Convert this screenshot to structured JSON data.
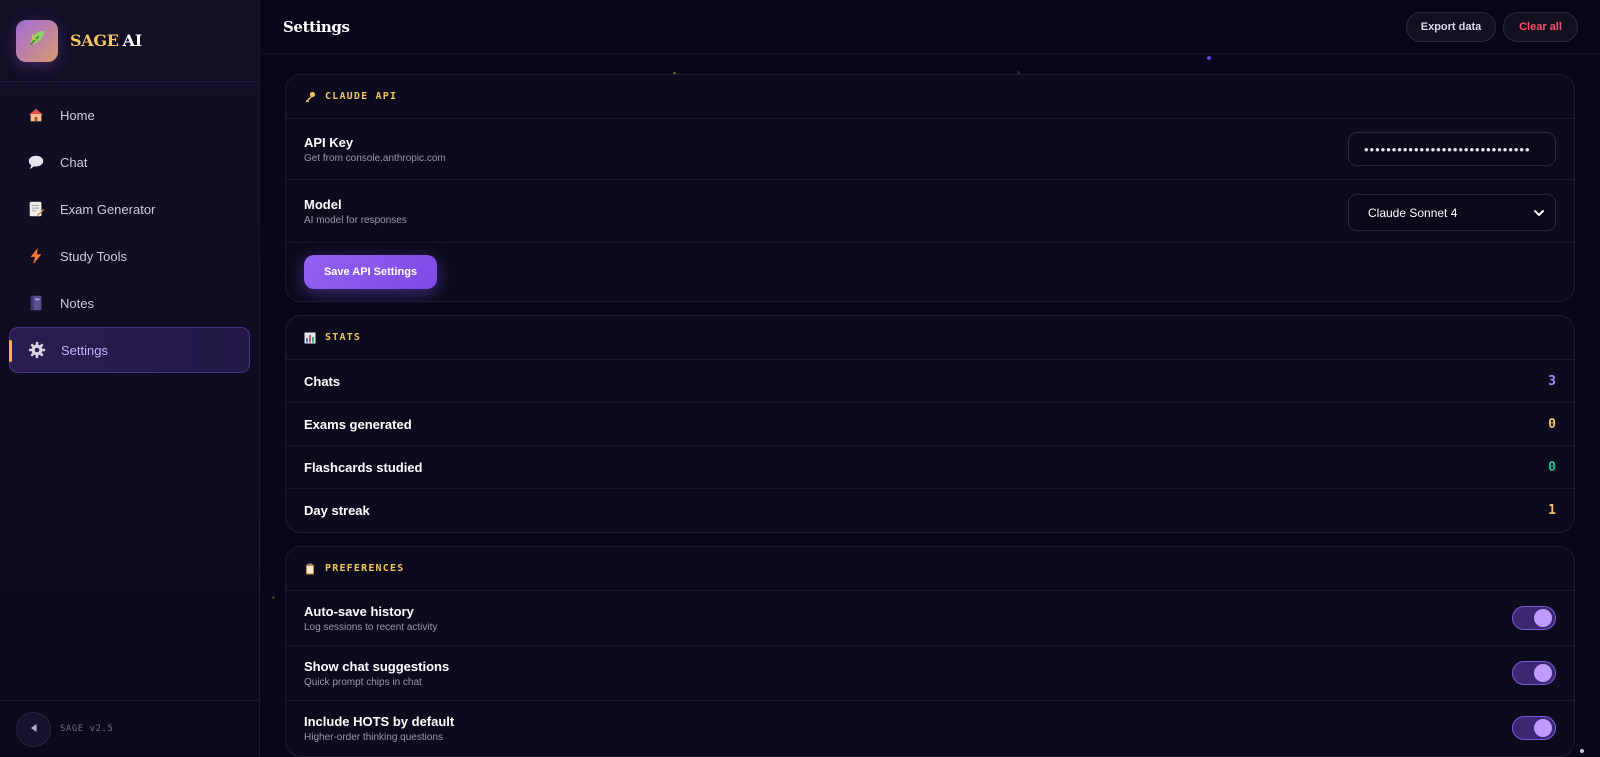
{
  "brand": {
    "name_part1": "SAGE",
    "name_part2": "AI",
    "logo_icon": "leaf-icon"
  },
  "sidebar": {
    "items": [
      {
        "label": "Home",
        "icon": "house-icon",
        "active": false
      },
      {
        "label": "Chat",
        "icon": "speech-bubble-icon",
        "active": false
      },
      {
        "label": "Exam Generator",
        "icon": "document-icon",
        "active": false
      },
      {
        "label": "Study Tools",
        "icon": "lightning-icon",
        "active": false
      },
      {
        "label": "Notes",
        "icon": "notebook-icon",
        "active": false
      },
      {
        "label": "Settings",
        "icon": "gear-icon",
        "active": true
      }
    ],
    "version": "SAGE v2.5",
    "collapse_icon": "triangle-left-icon"
  },
  "topbar": {
    "title": "Settings",
    "export_label": "Export data",
    "clear_label": "Clear all"
  },
  "claude_api": {
    "header": "CLAUDE API",
    "header_icon": "key-icon",
    "api_key": {
      "title": "API Key",
      "subtitle": "Get from console.anthropic.com",
      "value": "••••••••••••••••••••••••••••••"
    },
    "model": {
      "title": "Model",
      "subtitle": "AI model for responses",
      "selected": "Claude Sonnet 4"
    },
    "save_label": "Save API Settings"
  },
  "stats": {
    "header": "STATS",
    "header_icon": "bar-chart-icon",
    "rows": [
      {
        "label": "Chats",
        "value": "3",
        "color": "#a78bfa"
      },
      {
        "label": "Exams generated",
        "value": "0",
        "color": "#f0c560"
      },
      {
        "label": "Flashcards studied",
        "value": "0",
        "color": "#22c58e"
      },
      {
        "label": "Day streak",
        "value": "1",
        "color": "#f0c560"
      }
    ]
  },
  "preferences": {
    "header": "PREFERENCES",
    "header_icon": "clipboard-icon",
    "rows": [
      {
        "title": "Auto-save history",
        "subtitle": "Log sessions to recent activity",
        "on": true
      },
      {
        "title": "Show chat suggestions",
        "subtitle": "Quick prompt chips in chat",
        "on": true
      },
      {
        "title": "Include HOTS by default",
        "subtitle": "Higher-order thinking questions",
        "on": true
      }
    ]
  },
  "colors": {
    "accent": "#8b5cf6",
    "gold": "#f0c560",
    "danger": "#ff4f6d",
    "background": "#07061a"
  }
}
